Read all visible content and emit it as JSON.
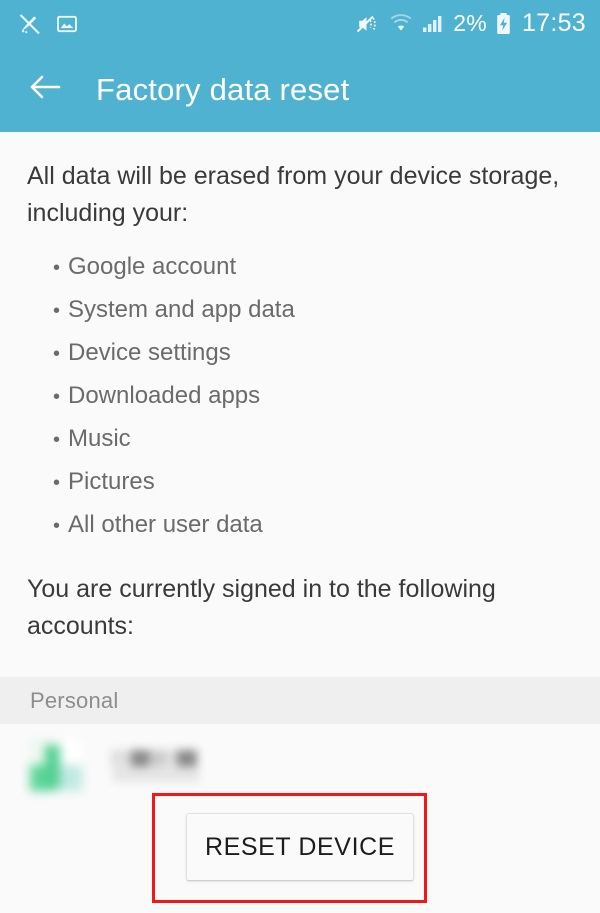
{
  "status_bar": {
    "left_icons": [
      {
        "name": "no-capture-icon",
        "glyph": "quill-crossed"
      },
      {
        "name": "photo-icon",
        "glyph": "picture-frame"
      }
    ],
    "right_icons": [
      {
        "name": "mute-vibrate-icon",
        "glyph": "speaker-muted"
      },
      {
        "name": "wifi-icon",
        "glyph": "wifi"
      },
      {
        "name": "cellular-signal-icon",
        "glyph": "signal-bars"
      }
    ],
    "battery_percent": "2%",
    "battery_state": "charging",
    "clock": "17:53",
    "background_color": "#4FB2D1"
  },
  "app_bar": {
    "back_label": "Back",
    "title": "Factory data reset",
    "background_color": "#4FB2D1"
  },
  "body": {
    "intro": "All data will be erased from your device storage, including your:",
    "bullet_marker": "•",
    "erased_items": [
      "Google account",
      "System and app data",
      "Device settings",
      "Downloaded apps",
      "Music",
      "Pictures",
      "All other user data"
    ],
    "signed_in_note": "You are currently signed in to the following accounts:"
  },
  "accounts_section": {
    "header": "Personal",
    "rows": [
      {
        "avatar": "blurred-green-avatar",
        "name": "",
        "redacted": true
      }
    ]
  },
  "action": {
    "reset_button_label": "RESET DEVICE"
  },
  "annotation": {
    "highlight_color": "#f51717",
    "target": "reset-device-button"
  }
}
